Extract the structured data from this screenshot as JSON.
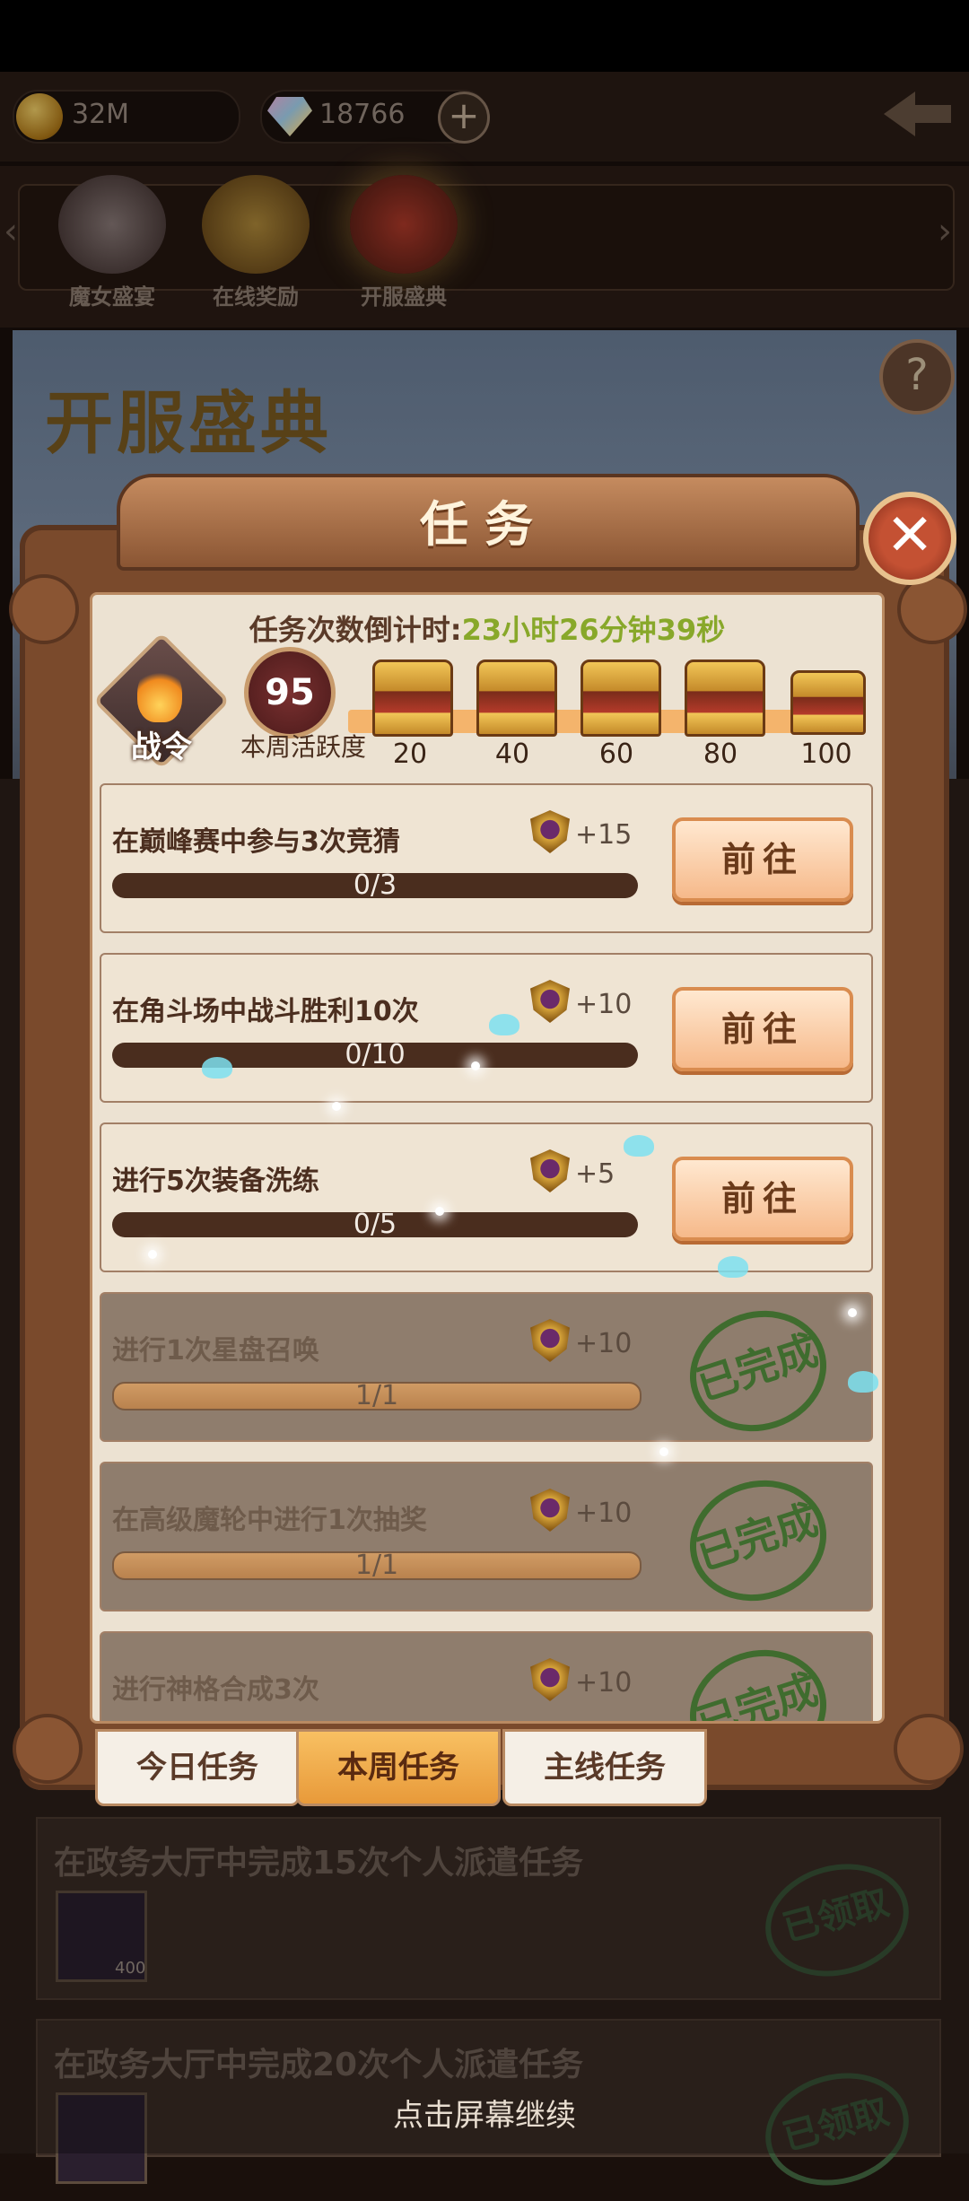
{
  "resources": {
    "gold": "32M",
    "gems": "18766"
  },
  "nav": {
    "items": [
      {
        "label": "魔女盛宴",
        "icon": "witch-portrait-icon"
      },
      {
        "label": "在线奖励",
        "icon": "stopwatch-icon"
      },
      {
        "label": "开服盛典",
        "icon": "giftbox-icon"
      }
    ]
  },
  "banner": {
    "title": "开服盛典"
  },
  "background_tasks": [
    {
      "title": "在政务大厅中完成15次个人派遣任务",
      "crystal": "400",
      "stamp": "已领取"
    },
    {
      "title": "在政务大厅中完成20次个人派遣任务",
      "stamp": "已领取"
    }
  ],
  "dialog": {
    "title": "任务",
    "countdown_label": "任务次数倒计时:",
    "countdown_value": "23小时26分钟39秒",
    "war_order_label": "战令",
    "activity_value": "95",
    "activity_label": "本周活跃度",
    "milestones": [
      "20",
      "40",
      "60",
      "80",
      "100"
    ],
    "tasks": [
      {
        "title": "在巅峰赛中参与3次竞猜",
        "reward": "+15",
        "progress": "0/3",
        "button": "前往",
        "done": false
      },
      {
        "title": "在角斗场中战斗胜利10次",
        "reward": "+10",
        "progress": "0/10",
        "button": "前往",
        "done": false
      },
      {
        "title": "进行5次装备洗练",
        "reward": "+5",
        "progress": "0/5",
        "button": "前往",
        "done": false
      },
      {
        "title": "进行1次星盘召唤",
        "reward": "+10",
        "progress": "1/1",
        "stamp": "已完成",
        "done": true
      },
      {
        "title": "在高级魔轮中进行1次抽奖",
        "reward": "+10",
        "progress": "1/1",
        "stamp": "已完成",
        "done": true
      },
      {
        "title": "进行神格合成3次",
        "reward": "+10",
        "stamp": "已完成",
        "done": true
      }
    ],
    "tabs": [
      "今日任务",
      "本周任务",
      "主线任务"
    ],
    "active_tab": 1
  },
  "footer": {
    "continue": "点击屏幕继续"
  }
}
